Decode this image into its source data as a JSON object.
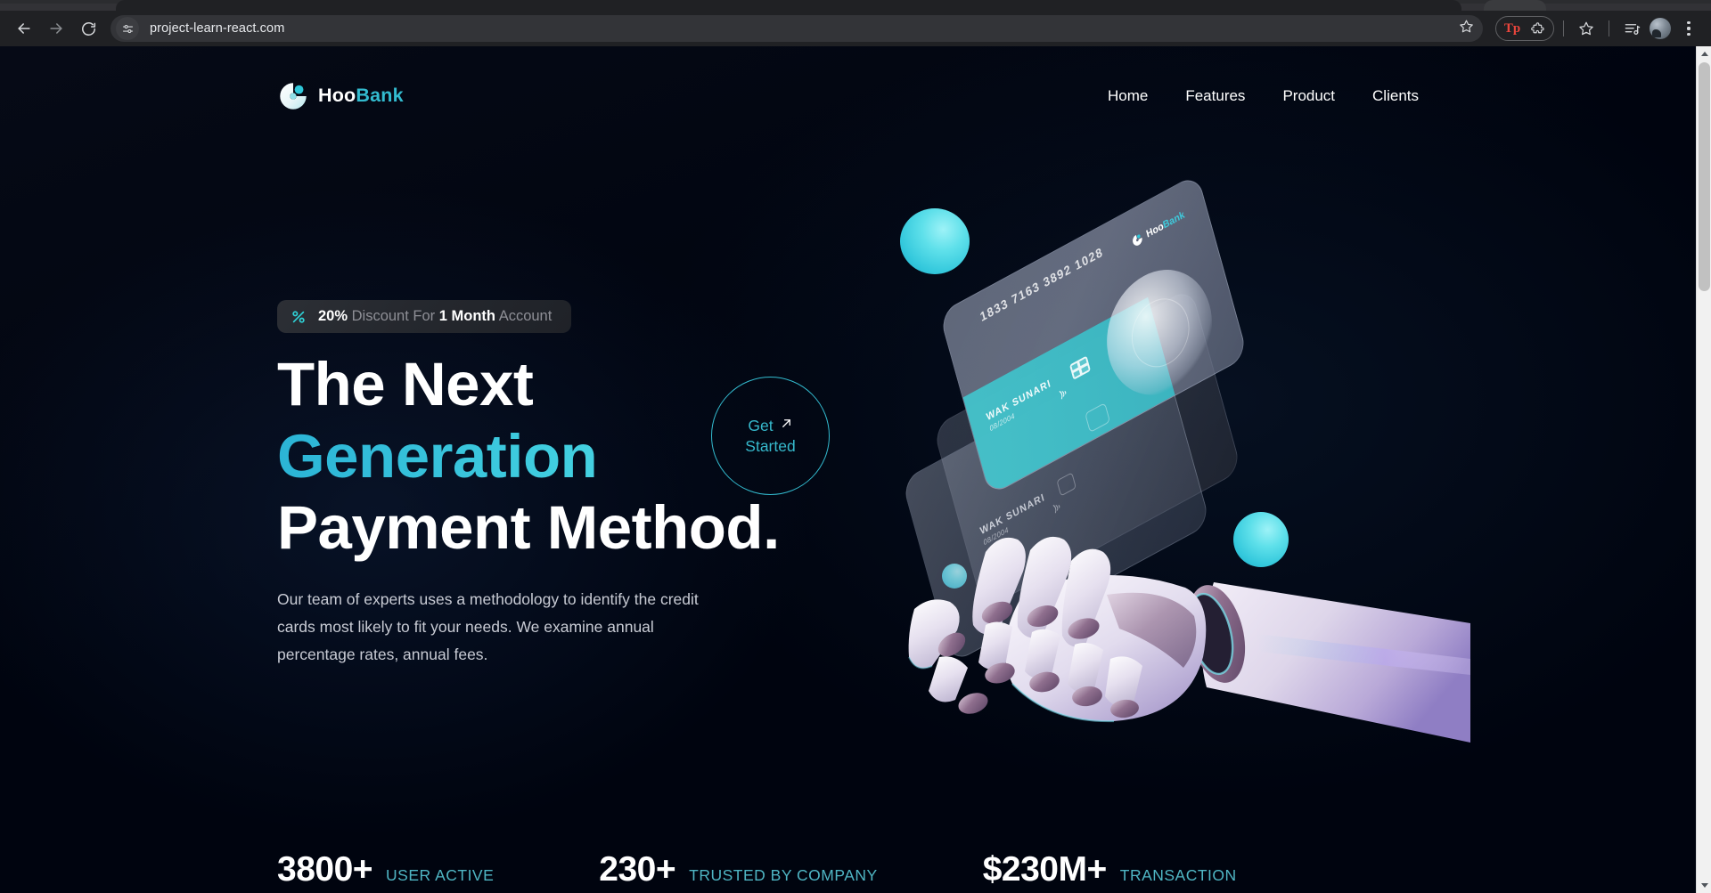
{
  "browser": {
    "url": "project-learn-react.com",
    "back_label": "Back",
    "forward_label": "Forward",
    "reload_label": "Reload",
    "site_info_label": "View site information",
    "bookmark_label": "Bookmark this tab",
    "extension_tp_label": "Tp",
    "extensions_label": "Extensions",
    "star_label": "Bookmarks",
    "reading_list_label": "Reading list",
    "profile_label": "Profile",
    "menu_label": "Customize and control Google Chrome"
  },
  "site": {
    "brand": {
      "name_white": "Hoo",
      "name_teal": "Bank"
    },
    "nav": [
      {
        "label": "Home"
      },
      {
        "label": "Features"
      },
      {
        "label": "Product"
      },
      {
        "label": "Clients"
      }
    ],
    "hero": {
      "discount": {
        "percent": "20%",
        "mid": "Discount For",
        "duration": "1 Month",
        "tail": "Account"
      },
      "headline_line1": "The Next",
      "headline_line2": "Generation",
      "headline_line3": "Payment Method.",
      "description": "Our team of experts uses a methodology to identify the credit cards most likely to fit your needs. We examine annual percentage rates, annual fees.",
      "cta": {
        "line1": "Get",
        "line2": "Started",
        "arrow": "↗"
      }
    },
    "card_art": {
      "number": "1833 7163 3892 1028",
      "holder": "WAK SUNARI",
      "expiry": "08/2004",
      "brand_white": "Hoo",
      "brand_teal": "Bank"
    },
    "stats": [
      {
        "value": "3800+",
        "label": "User Active"
      },
      {
        "value": "230+",
        "label": "Trusted by Company"
      },
      {
        "value": "$230M+",
        "label": "Transaction"
      }
    ]
  },
  "colors": {
    "page_bg": "#00040f",
    "accent_teal": "#33bbcf",
    "text_white": "#ffffff",
    "text_dim": "#c8cbd4",
    "stat_label": "#4fb6c4",
    "browser_bg": "#202124"
  }
}
